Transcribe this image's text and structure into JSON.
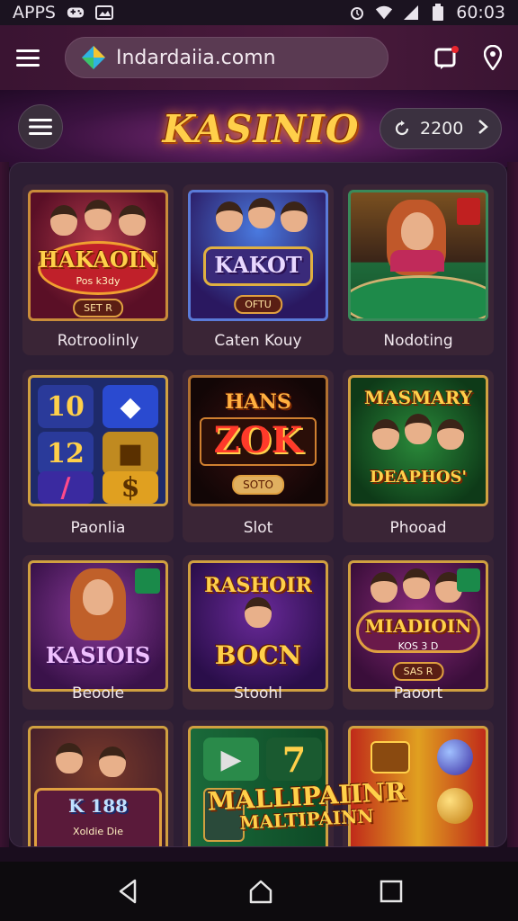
{
  "status_bar": {
    "left_label": "APPS",
    "time": "60:03"
  },
  "browser": {
    "url": "Indardaiia.comn"
  },
  "header": {
    "logo": "KASINIO",
    "coins": "2200"
  },
  "games": [
    {
      "label": "Rotroolinly",
      "art_title": "HAKAOIN",
      "art_sub": "Pos k3dy",
      "art_badge": "SET R"
    },
    {
      "label": "Caten Kouy",
      "art_title": "KAKOT",
      "art_sub": "OFTU",
      "art_badge": ""
    },
    {
      "label": "Nodoting",
      "art_title": "",
      "art_sub": "",
      "art_badge": ""
    },
    {
      "label": "Paonlia",
      "art_title": "",
      "art_sub": "",
      "art_badge": ""
    },
    {
      "label": "Slot",
      "art_title": "ZOK",
      "art_top": "HANS",
      "art_sub": "SOTO",
      "art_badge": ""
    },
    {
      "label": "Phooad",
      "art_title": "MASMARY",
      "art_sub": "DEAPHOS'",
      "art_badge": ""
    },
    {
      "label": "Beoole",
      "art_title": "KASIOIS",
      "art_sub": "",
      "art_badge": ""
    },
    {
      "label": "Stoohl",
      "art_title": "RASHOIR",
      "art_sub": "BOCN",
      "art_badge": ""
    },
    {
      "label": "Paoort",
      "art_title": "MIADIOIN",
      "art_sub": "KOS 3 D",
      "art_badge": "SAS R"
    },
    {
      "label": "",
      "art_title": "K 188",
      "art_sub": "Xoldie Die",
      "art_badge": ""
    },
    {
      "label": "",
      "art_title": "",
      "art_sub": "",
      "art_badge": ""
    },
    {
      "label": "",
      "art_title": "MALLIPAIINR",
      "art_sub": "MALTIPAINN",
      "art_badge": ""
    }
  ],
  "tiles": [
    "10",
    "12"
  ],
  "colors": {
    "accent_gold": "#ffd04a",
    "panel_bg": "#2d1e34",
    "header_purple": "#7b2b7a"
  },
  "icons": [
    "menu-icon",
    "map-pin-icon",
    "chat-notification-icon",
    "refresh-icon",
    "chevron-right-icon",
    "back-icon",
    "home-icon",
    "recents-icon"
  ]
}
